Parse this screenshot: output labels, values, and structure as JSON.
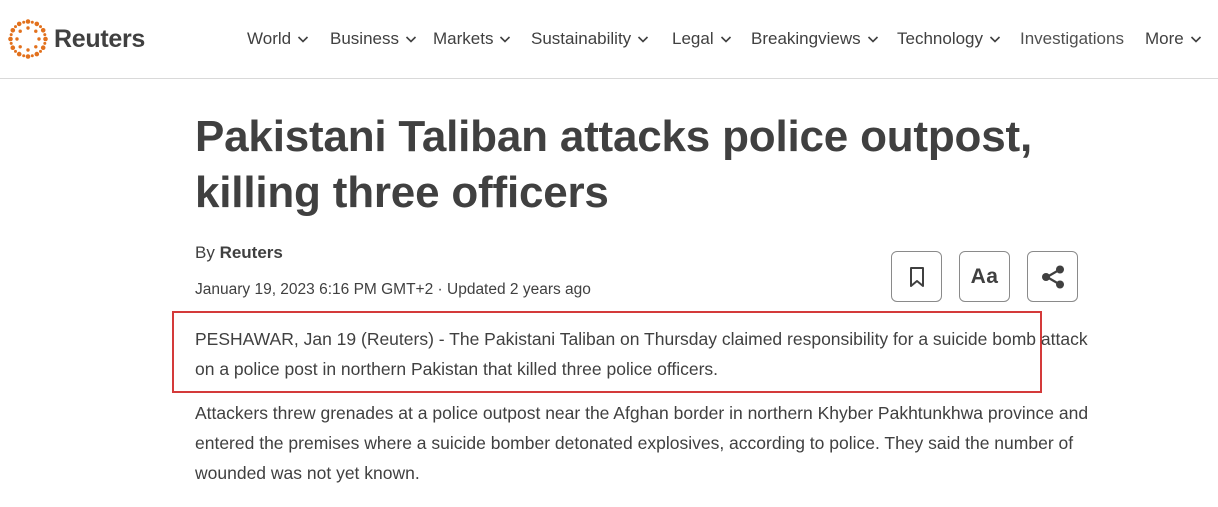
{
  "header": {
    "brand": "Reuters",
    "brand_color": "#e2711d",
    "nav": [
      {
        "label": "World",
        "has_menu": true
      },
      {
        "label": "Business",
        "has_menu": true
      },
      {
        "label": "Markets",
        "has_menu": true
      },
      {
        "label": "Sustainability",
        "has_menu": true
      },
      {
        "label": "Legal",
        "has_menu": true
      },
      {
        "label": "Breakingviews",
        "has_menu": true
      },
      {
        "label": "Technology",
        "has_menu": true
      },
      {
        "label": "Investigations",
        "has_menu": false
      },
      {
        "label": "More",
        "has_menu": true
      }
    ]
  },
  "article": {
    "headline": "Pakistani Taliban attacks police outpost, killing three officers",
    "byline_prefix": "By ",
    "author": "Reuters",
    "dateline": "January 19, 2023 6:16 PM GMT+2 · Updated 2 years ago",
    "tools": {
      "bookmark_icon": "bookmark-icon",
      "text_size_label": "Aa",
      "share_icon": "share-icon"
    },
    "paragraphs": [
      "PESHAWAR, Jan 19 (Reuters) - The Pakistani Taliban on Thursday claimed responsibility for a suicide bomb attack on a police post in northern Pakistan that killed three police officers.",
      "Attackers threw grenades at a police outpost near the Afghan border in northern Khyber Pakhtunkhwa province and entered the premises where a suicide bomber detonated explosives, according to police. They said the number of wounded was not yet known."
    ],
    "highlight_color": "#d43a3a"
  }
}
